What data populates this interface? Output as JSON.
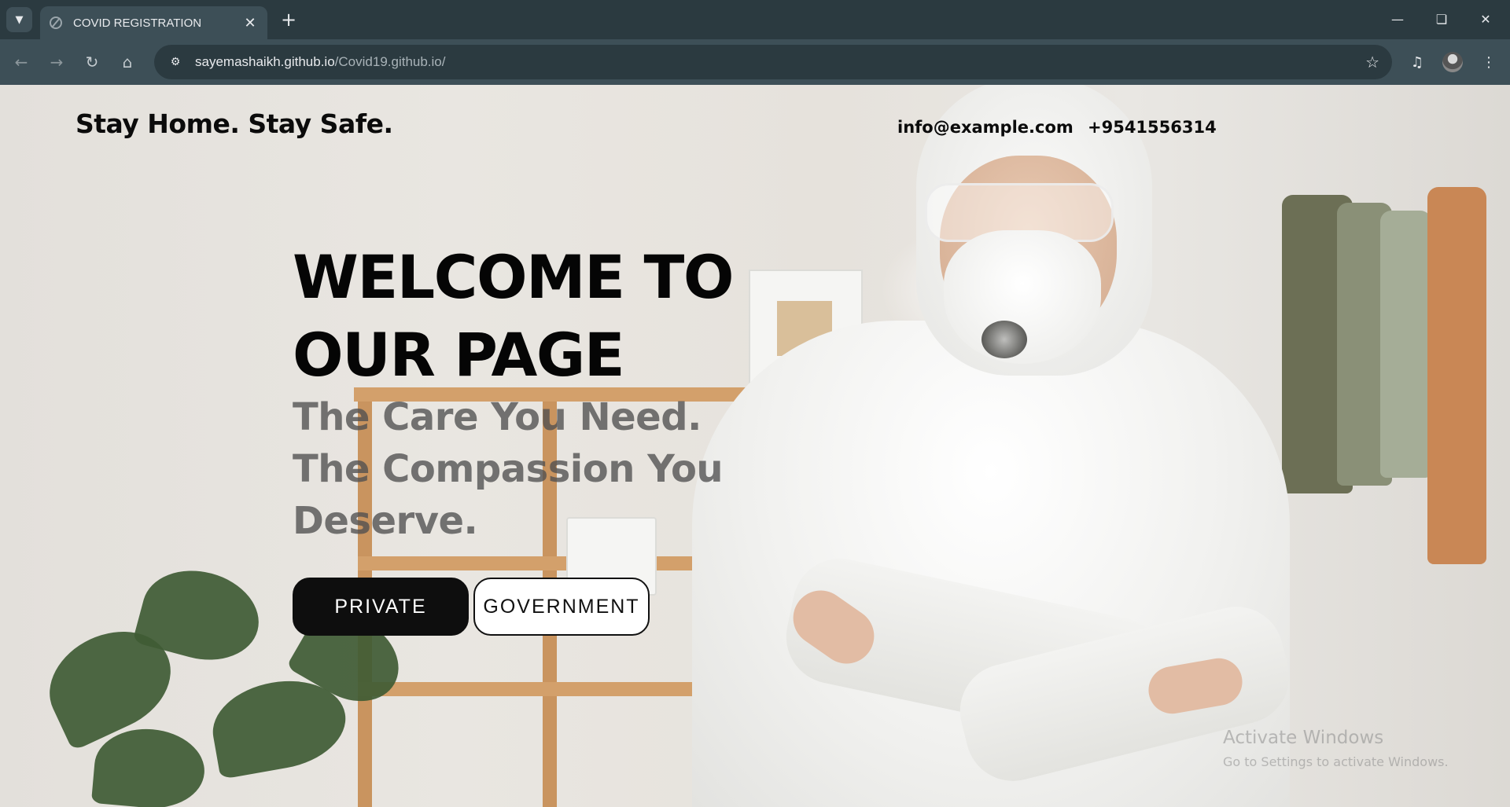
{
  "browser": {
    "tab_title": "COVID REGISTRATION",
    "url_host": "sayemashaikh.github.io",
    "url_path": "/Covid19.github.io/"
  },
  "header": {
    "brand": "Stay Home. Stay Safe.",
    "email": "info@example.com",
    "phone": "+9541556314"
  },
  "hero": {
    "title_line1": "WELCOME TO",
    "title_line2": "OUR PAGE",
    "subtitle_line1": "The Care You Need.",
    "subtitle_line2": "The Compassion You",
    "subtitle_line3": "Deserve.",
    "private_label": "PRIVATE",
    "government_label": "GOVERNMENT"
  },
  "os_watermark": {
    "title": "Activate Windows",
    "subtitle": "Go to Settings to activate Windows."
  },
  "icons": {
    "tab_search": "chevron-down-icon",
    "favicon": "globe-icon",
    "tab_close": "close-icon",
    "new_tab": "plus-icon",
    "back": "arrow-left-icon",
    "forward": "arrow-right-icon",
    "reload": "reload-icon",
    "home": "home-icon",
    "site_info": "tune-icon",
    "bookmark": "star-icon",
    "media": "playlist-icon",
    "profile": "avatar-icon",
    "menu": "kebab-menu-icon"
  },
  "colors": {
    "chrome_dark": "#2b3a40",
    "chrome_light": "#3d4f57",
    "text_dark": "#0b0b0b",
    "button_dark": "#0e0e0e",
    "button_light": "#ffffff"
  }
}
